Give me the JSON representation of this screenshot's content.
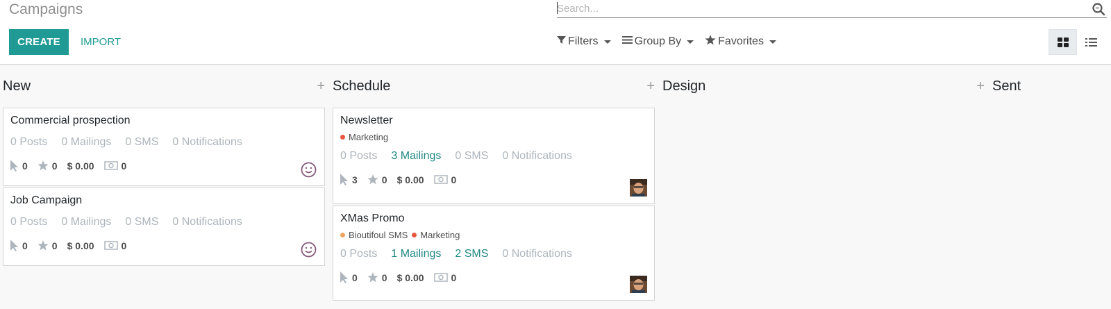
{
  "page": {
    "title": "Campaigns"
  },
  "search": {
    "placeholder": "Search..."
  },
  "buttons": {
    "create": "CREATE",
    "import": "IMPORT"
  },
  "search_options": {
    "filters": "Filters",
    "group_by": "Group By",
    "favorites": "Favorites"
  },
  "view_switch": {
    "active": "kanban",
    "views": [
      "kanban-icon",
      "list-icon"
    ]
  },
  "colors": {
    "accent": "#1f9a94",
    "link": "#1f8883",
    "muted": "#adb5bd",
    "tag_marketing": "#e9573f",
    "tag_bioutifoul": "#f0a35e",
    "smiley": "#875a7b"
  },
  "columns": [
    {
      "title": "New",
      "cards": [
        {
          "title": "Commercial prospection",
          "tags": [],
          "stats": [
            "0 Posts",
            "0 Mailings",
            "0 SMS",
            "0 Notifications"
          ],
          "clicks": "0",
          "favorites": "0",
          "revenue": "$ 0.00",
          "cost": "0",
          "user": "smiley-icon"
        },
        {
          "title": "Job Campaign",
          "tags": [],
          "stats": [
            "0 Posts",
            "0 Mailings",
            "0 SMS",
            "0 Notifications"
          ],
          "clicks": "0",
          "favorites": "0",
          "revenue": "$ 0.00",
          "cost": "0",
          "user": "smiley-icon"
        }
      ]
    },
    {
      "title": "Schedule",
      "cards": [
        {
          "title": "Newsletter",
          "tags": [
            "Marketing"
          ],
          "stats": [
            "0 Posts",
            "3 Mailings",
            "0 SMS",
            "0 Notifications"
          ],
          "clicks": "3",
          "favorites": "0",
          "revenue": "$ 0.00",
          "cost": "0",
          "user": "avatar"
        },
        {
          "title": "XMas Promo",
          "tags": [
            "Bioutifoul SMS",
            "Marketing"
          ],
          "stats": [
            "0 Posts",
            "1 Mailings",
            "2 SMS",
            "0 Notifications"
          ],
          "clicks": "0",
          "favorites": "0",
          "revenue": "$ 0.00",
          "cost": "0",
          "user": "avatar"
        }
      ]
    },
    {
      "title": "Design",
      "cards": []
    },
    {
      "title": "Sent",
      "cards": []
    }
  ]
}
